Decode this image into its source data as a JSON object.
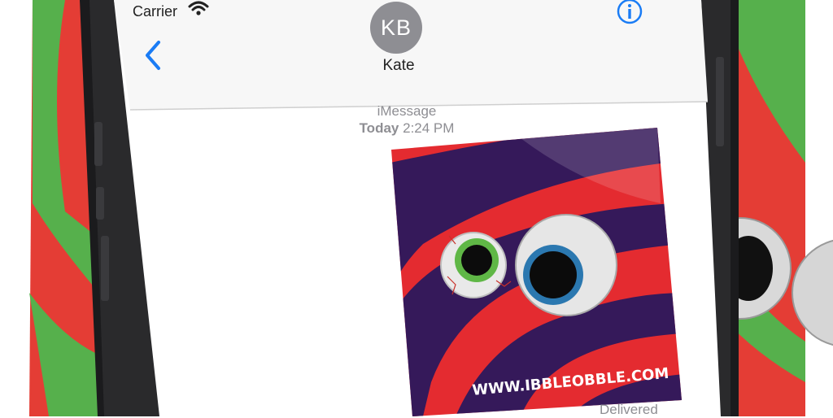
{
  "status_bar": {
    "carrier": "Carrier"
  },
  "header": {
    "back_icon": "chevron-left-icon",
    "avatar_initials": "KB",
    "contact_name": "Kate",
    "info_icon": "info-icon"
  },
  "thread": {
    "service": "iMessage",
    "day": "Today",
    "time": "2:24 PM",
    "delivery_status": "Delivered"
  },
  "message_image": {
    "url_text": "WWW.IBBLEOBBLE.COM"
  },
  "colors": {
    "accent": "#1a7cf5",
    "background_red": "#e43d35",
    "background_green": "#56b04c",
    "image_purple": "#35195a",
    "image_red": "#e42b30"
  }
}
